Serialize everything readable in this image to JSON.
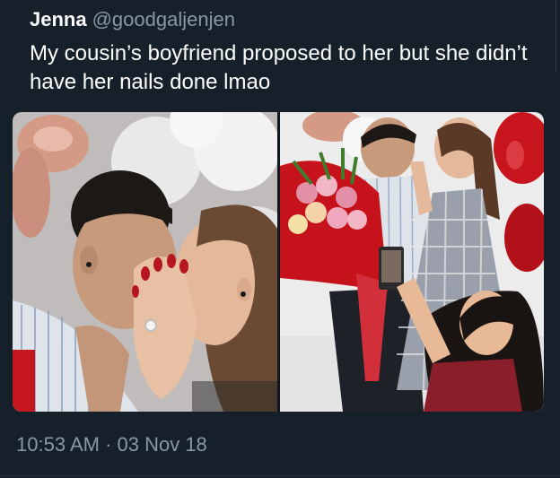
{
  "tweet": {
    "author_name": "Jenna",
    "author_handle": "@goodgaljenjen",
    "text": "My cousin’s boyfriend proposed to her but she didn’t have her nails done lmao",
    "timestamp": "10:53 AM · 03 Nov 18"
  },
  "media": {
    "photo_count": 2
  },
  "colors": {
    "background": "#15202b",
    "text_primary": "#ffffff",
    "text_secondary": "#8899a6"
  }
}
